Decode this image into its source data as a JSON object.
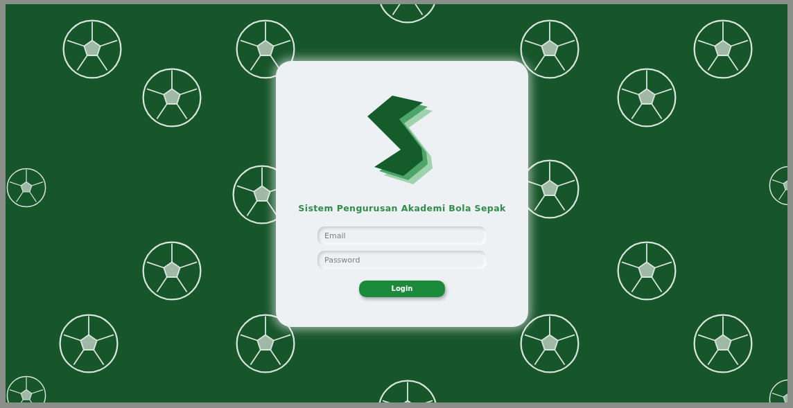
{
  "title": "Sistem Pengurusan Akademi Bola Sepak",
  "fields": [
    {
      "placeholder": "Email"
    },
    {
      "placeholder": "Password"
    }
  ],
  "button": "Login"
}
